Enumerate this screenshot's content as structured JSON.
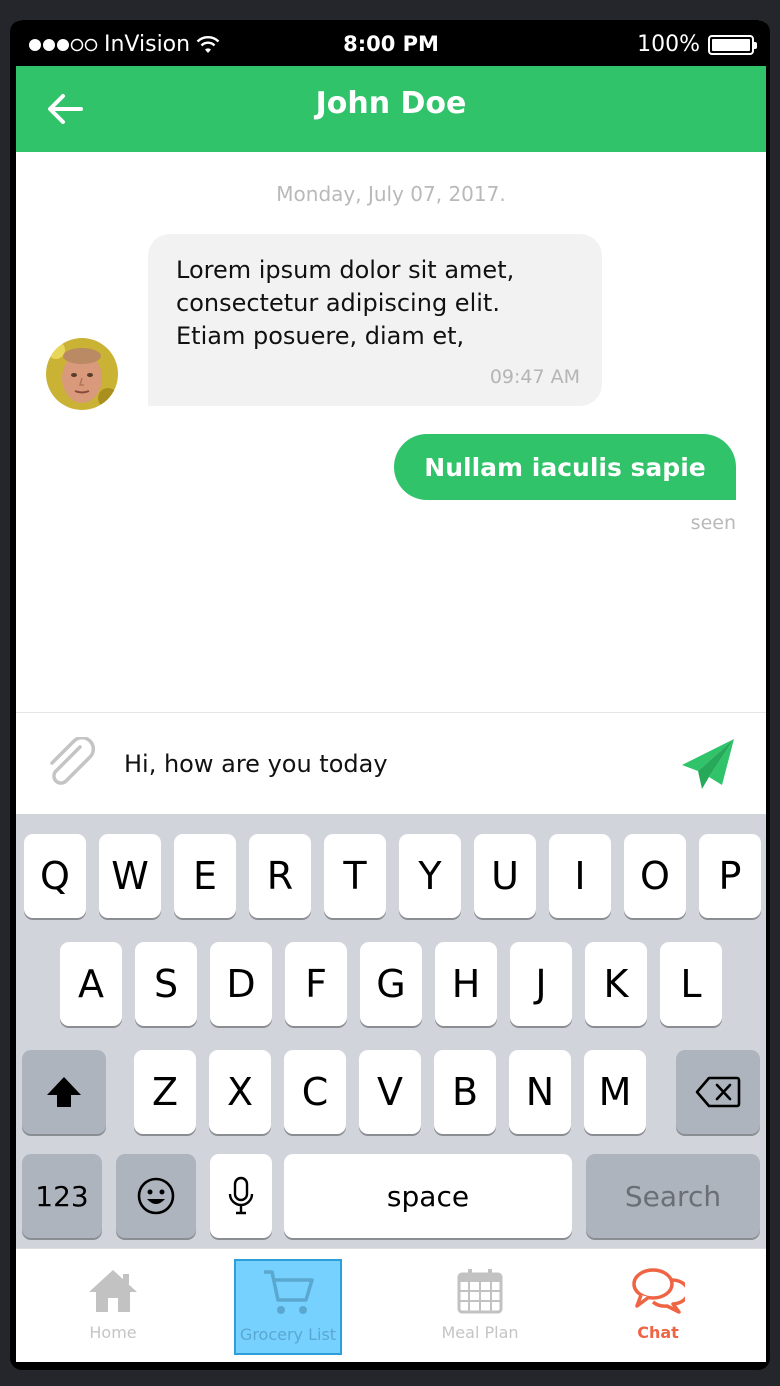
{
  "status_bar": {
    "carrier": "InVision",
    "time": "8:00 PM",
    "battery": "100%"
  },
  "header": {
    "title": "John Doe"
  },
  "chat": {
    "date": "Monday, July 07, 2017.",
    "incoming": {
      "text": "Lorem ipsum dolor sit amet,\nconsectetur adipiscing elit.\nEtiam posuere, diam et,",
      "time": "09:47 AM"
    },
    "outgoing": {
      "text": "Nullam iaculis sapie",
      "status": "seen"
    }
  },
  "composer": {
    "value": "Hi, how are you today"
  },
  "keyboard": {
    "row1": [
      "Q",
      "W",
      "E",
      "R",
      "T",
      "Y",
      "U",
      "I",
      "O",
      "P"
    ],
    "row2": [
      "A",
      "S",
      "D",
      "F",
      "G",
      "H",
      "J",
      "K",
      "L"
    ],
    "row3": [
      "Z",
      "X",
      "C",
      "V",
      "B",
      "N",
      "M"
    ],
    "numbers_label": "123",
    "space_label": "space",
    "search_label": "Search"
  },
  "tabs": [
    {
      "label": "Home"
    },
    {
      "label": "Grocery List"
    },
    {
      "label": "Meal Plan"
    },
    {
      "label": "Chat"
    }
  ],
  "colors": {
    "brand_green": "#30c36a",
    "chat_active": "#ef6443",
    "highlight": "#48c2ff"
  }
}
